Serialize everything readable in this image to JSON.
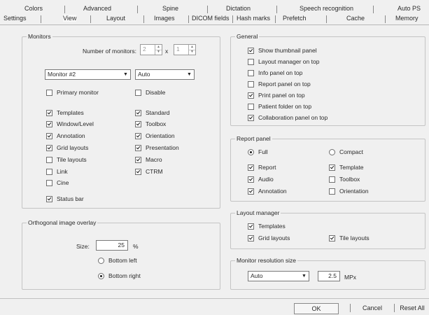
{
  "tabs": {
    "row1": [
      "Colors",
      "Advanced",
      "Spine",
      "Dictation",
      "Speech recognition",
      "Auto PS"
    ],
    "row2": [
      "Settings",
      "View",
      "Layout",
      "Images",
      "DICOM fields",
      "Hash marks",
      "Prefetch",
      "Cache",
      "Memory"
    ],
    "active": "View"
  },
  "monitors": {
    "title": "Monitors",
    "number_label": "Number of monitors:",
    "cols_value": "2",
    "times": "x",
    "rows_value": "1",
    "monitor_select": "Monitor #2",
    "mode_select": "Auto",
    "primary_label": "Primary monitor",
    "disable_label": "Disable",
    "left_items": [
      {
        "label": "Templates",
        "checked": true
      },
      {
        "label": "Window/Level",
        "checked": true
      },
      {
        "label": "Annotation",
        "checked": true
      },
      {
        "label": "Grid layouts",
        "checked": true
      },
      {
        "label": "Tile layouts",
        "checked": false
      },
      {
        "label": "Link",
        "checked": false
      },
      {
        "label": "Cine",
        "checked": false
      }
    ],
    "right_items": [
      {
        "label": "Standard",
        "checked": true
      },
      {
        "label": "Toolbox",
        "checked": true
      },
      {
        "label": "Orientation",
        "checked": true
      },
      {
        "label": "Presentation",
        "checked": true
      },
      {
        "label": "Macro",
        "checked": true
      },
      {
        "label": "CTRM",
        "checked": true
      }
    ],
    "status_bar": {
      "label": "Status bar",
      "checked": true
    }
  },
  "ortho": {
    "title": "Orthogonal image overlay",
    "size_label": "Size:",
    "size_value": "25",
    "unit": "%",
    "bottom_left": "Bottom left",
    "bottom_right": "Bottom right",
    "selected": "bottom_right"
  },
  "general": {
    "title": "General",
    "items": [
      {
        "label": "Show thumbnail panel",
        "checked": true
      },
      {
        "label": "Layout manager on top",
        "checked": false
      },
      {
        "label": "Info panel on top",
        "checked": false
      },
      {
        "label": "Report panel on top",
        "checked": false
      },
      {
        "label": "Print panel on top",
        "checked": true
      },
      {
        "label": "Patient folder on top",
        "checked": false
      },
      {
        "label": "Collaboration panel on top",
        "checked": true
      }
    ]
  },
  "report": {
    "title": "Report panel",
    "full_label": "Full",
    "compact_label": "Compact",
    "selected": "full",
    "left_items": [
      {
        "label": "Report",
        "checked": true
      },
      {
        "label": "Audio",
        "checked": true
      },
      {
        "label": "Annotation",
        "checked": true
      }
    ],
    "right_items": [
      {
        "label": "Template",
        "checked": true
      },
      {
        "label": "Toolbox",
        "checked": false
      },
      {
        "label": "Orientation",
        "checked": false
      }
    ]
  },
  "layout_manager": {
    "title": "Layout manager",
    "templates": {
      "label": "Templates",
      "checked": true
    },
    "grid": {
      "label": "Grid layouts",
      "checked": true
    },
    "tile": {
      "label": "Tile layouts",
      "checked": true
    }
  },
  "resolution": {
    "title": "Monitor resolution size",
    "select": "Auto",
    "value": "2.5",
    "unit": "MPx"
  },
  "buttons": {
    "ok": "OK",
    "cancel": "Cancel",
    "reset": "Reset All"
  }
}
